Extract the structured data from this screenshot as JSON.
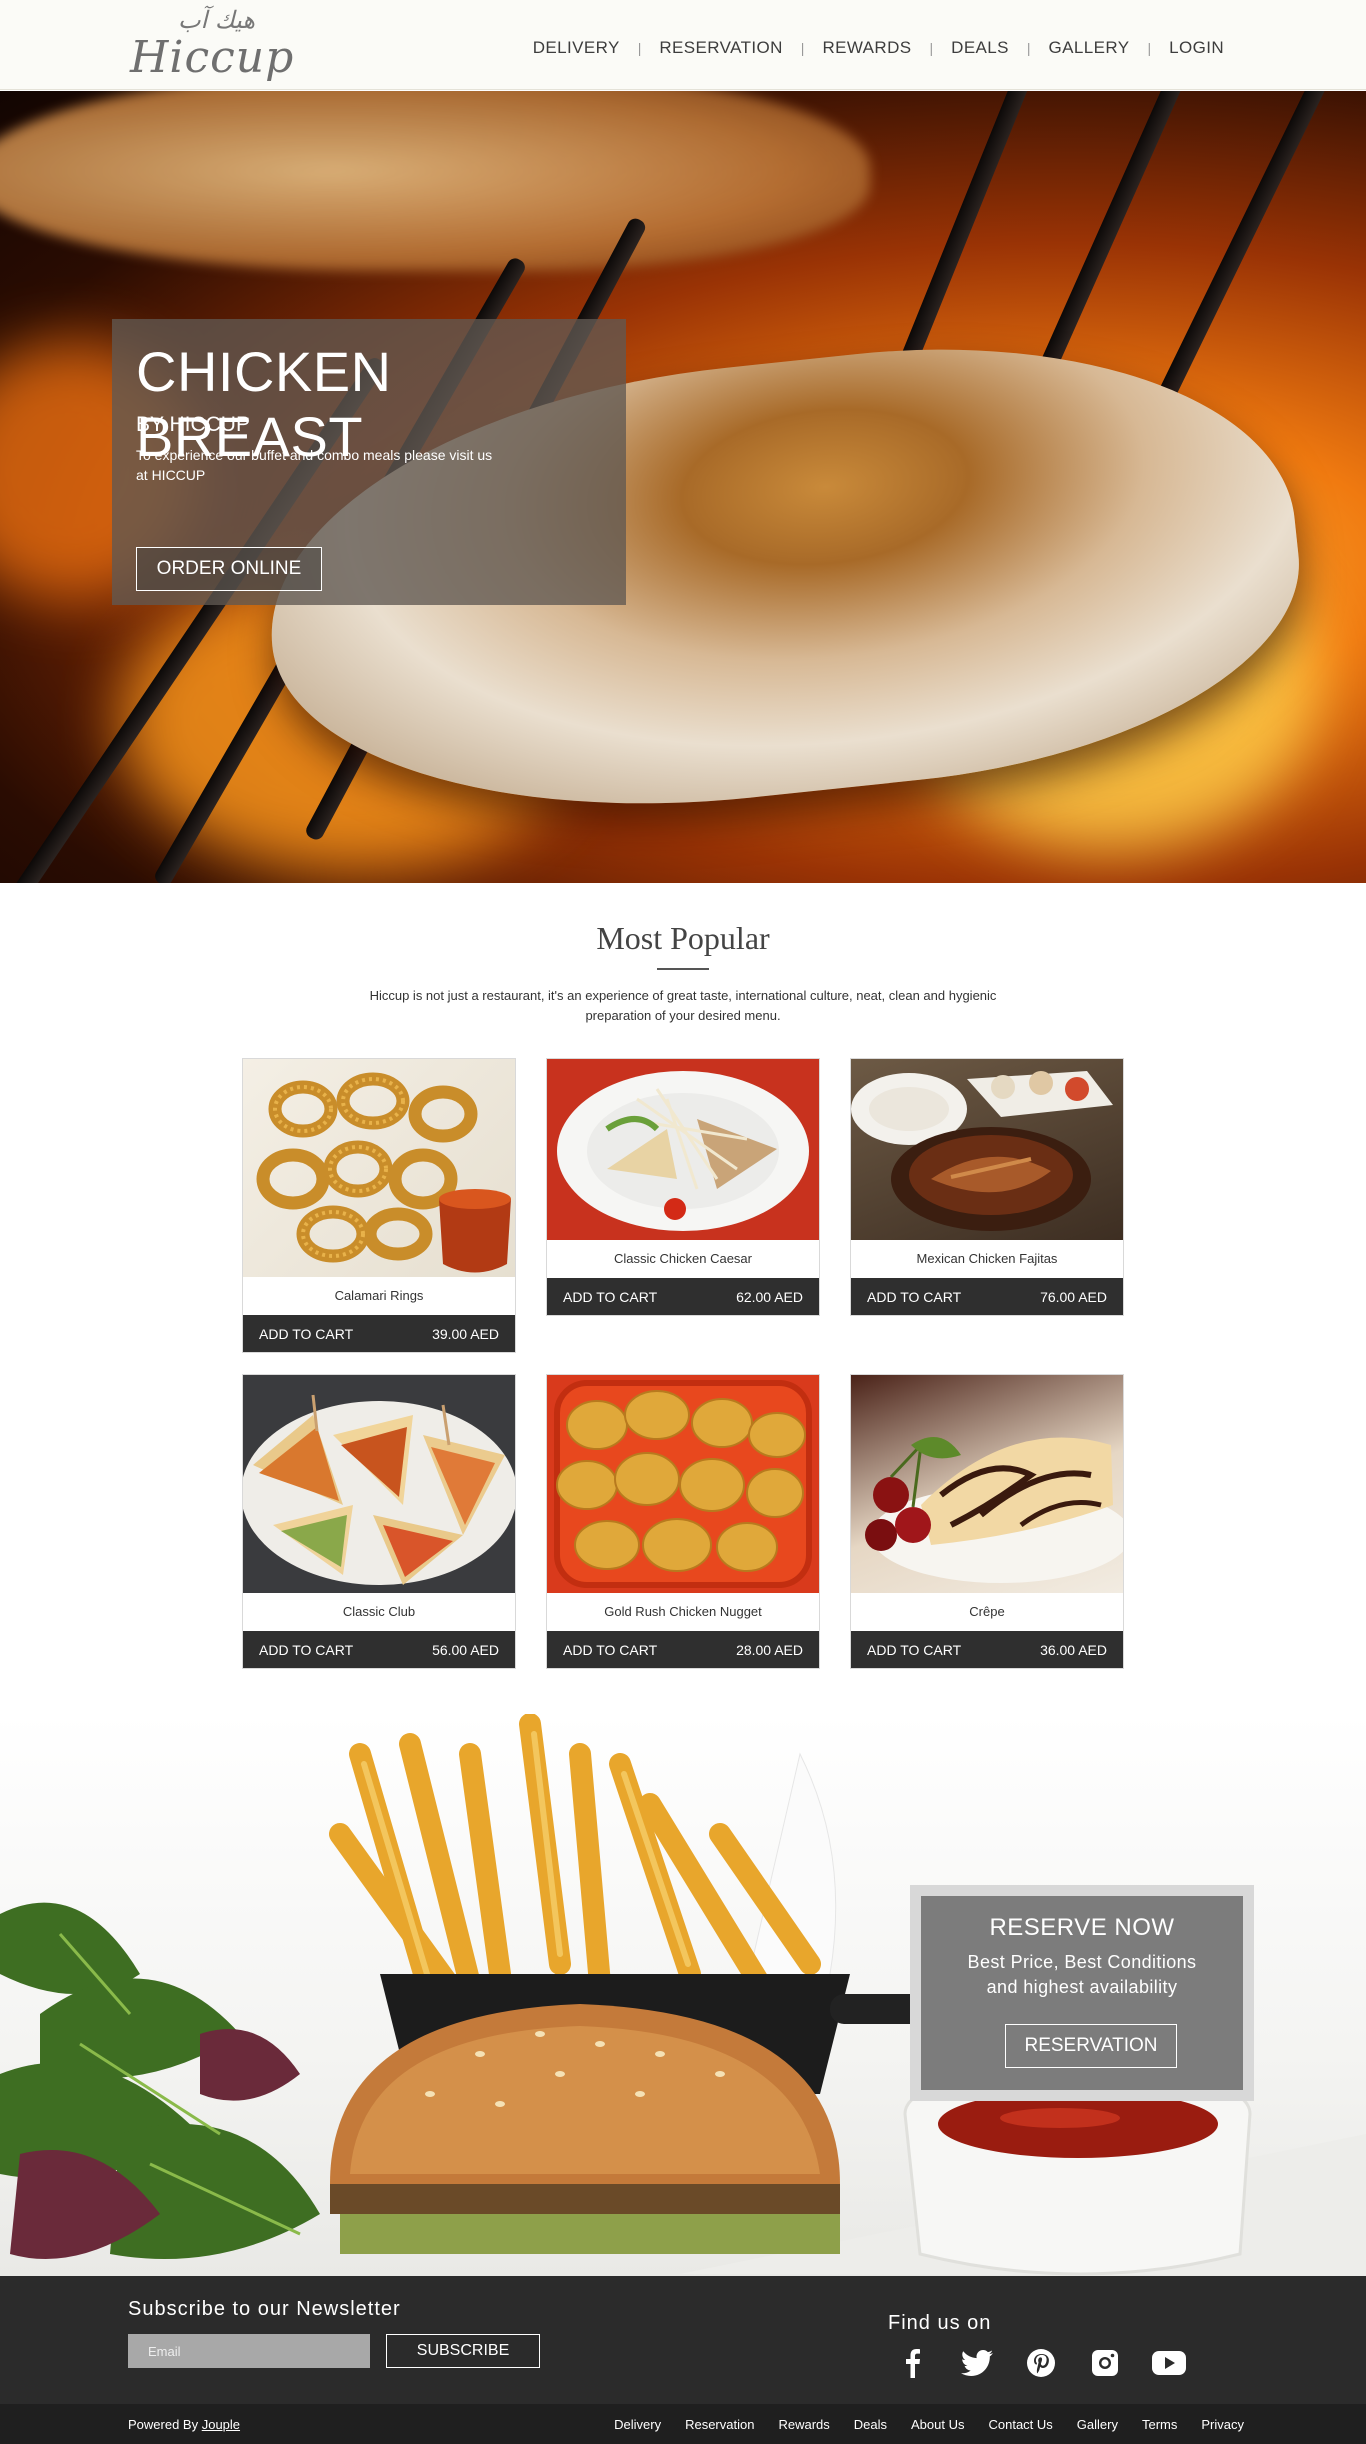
{
  "brand": {
    "logo_arabic": "هيك آب",
    "logo_text": "Hiccup"
  },
  "nav": [
    "DELIVERY",
    "RESERVATION",
    "REWARDS",
    "DEALS",
    "GALLERY",
    "LOGIN"
  ],
  "hero": {
    "title": "CHICKEN BREAST",
    "subtitle": "BY HICCUP",
    "text": "To experience our buffet and combo meals please visit us at HICCUP",
    "button": "ORDER ONLINE"
  },
  "popular": {
    "title": "Most Popular",
    "description": "Hiccup is not just a restaurant, it's an experience of great taste, international culture, neat, clean and hygienic preparation of your desired menu.",
    "items": [
      {
        "name": "Calamari Rings",
        "add_label": "ADD TO CART",
        "price": "39.00 AED"
      },
      {
        "name": "Classic Chicken Caesar",
        "add_label": "ADD TO CART",
        "price": "62.00 AED"
      },
      {
        "name": "Mexican Chicken Fajitas",
        "add_label": "ADD TO CART",
        "price": "76.00 AED"
      },
      {
        "name": "Classic Club",
        "add_label": "ADD TO CART",
        "price": "56.00 AED"
      },
      {
        "name": "Gold Rush Chicken Nugget",
        "add_label": "ADD TO CART",
        "price": "28.00 AED"
      },
      {
        "name": "Crêpe",
        "add_label": "ADD TO CART",
        "price": "36.00 AED"
      }
    ]
  },
  "reserve": {
    "title": "RESERVE NOW",
    "line1": "Best Price, Best Conditions",
    "line2": "and highest availability",
    "button": "RESERVATION"
  },
  "newsletter": {
    "title": "Subscribe to our Newsletter",
    "placeholder": "Email",
    "button": "SUBSCRIBE"
  },
  "social": {
    "title": "Find us on",
    "icons": [
      "facebook-icon",
      "twitter-icon",
      "pinterest-icon",
      "instagram-icon",
      "youtube-icon"
    ]
  },
  "footer": {
    "powered_prefix": "Powered By",
    "powered_link": "Jouple",
    "links": [
      "Delivery",
      "Reservation",
      "Rewards",
      "Deals",
      "About Us",
      "Contact Us",
      "Gallery",
      "Terms",
      "Privacy"
    ]
  }
}
